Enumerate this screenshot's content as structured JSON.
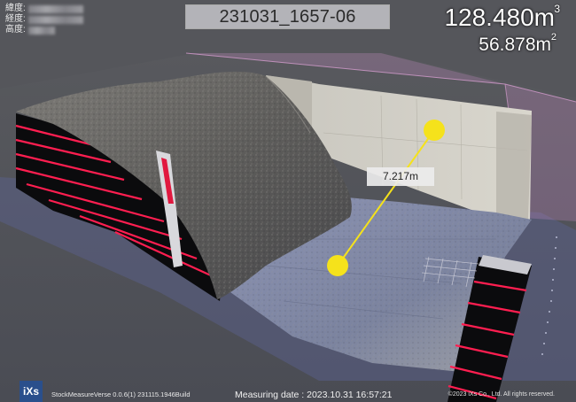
{
  "header": {
    "latitude_label": "緯度:",
    "longitude_label": "経度:",
    "altitude_label": "高度:",
    "title": "231031_1657-06"
  },
  "measurements": {
    "volume_value": "128.480m",
    "volume_unit_sup": "3",
    "area_value": "56.878m",
    "area_unit_sup": "2",
    "distance_label": "7.217m"
  },
  "footer": {
    "logo_text": "iXs",
    "version": "StockMeasureVerse 0.0.6(1)  231115.1946Build",
    "measuring_date": "Measuring date : 2023.10.31 16:57:21",
    "copyright": "©2023 iXs Co., Ltd. All rights reserved."
  },
  "colors": {
    "bg_floor": "#3d3f48",
    "wall_stripe": "#ff1e50",
    "marker": "#f5e21b",
    "bbox_pink": "#c98bc4"
  }
}
